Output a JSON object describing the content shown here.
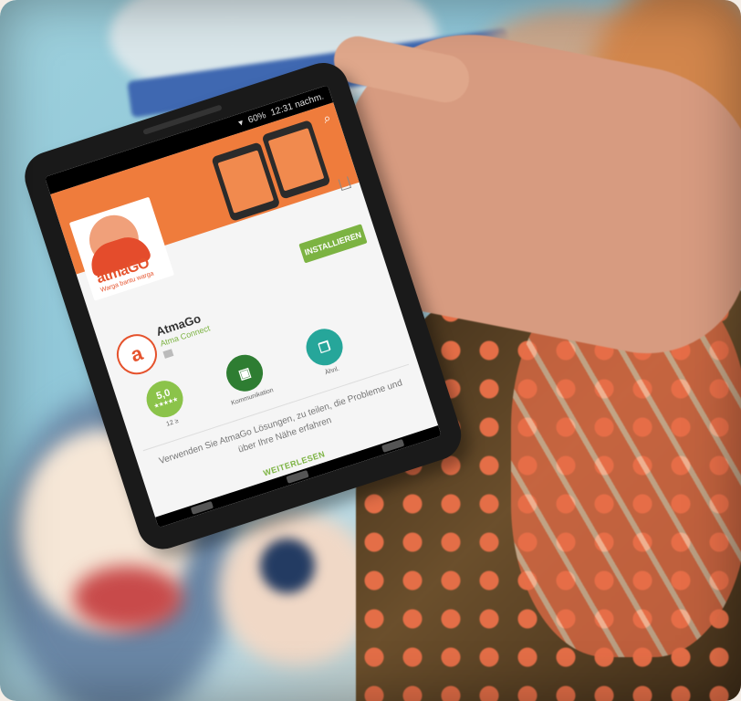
{
  "status_bar": {
    "signal": "▾",
    "battery": "60%",
    "time": "12:31 nachm."
  },
  "app_store_page": {
    "brand": "atmaGO",
    "tagline": "Warga bantu warga",
    "app_name": "AtmaGo",
    "developer": "Atma Connect",
    "install_label": "INSTALLIEREN",
    "badges": [
      {
        "value": "5,0",
        "sub": "★★★★★",
        "label": "12 ≥"
      },
      {
        "value": "▣",
        "label": "Kommunikation"
      },
      {
        "value": "❐",
        "label": "Ähnl."
      }
    ],
    "description": "Verwenden Sie AtmaGo Lösungen, zu teilen, die Probleme und über Ihre Nähe erfahren",
    "more_label": "WEITERLESEN"
  },
  "colors": {
    "accent": "#ef7c3c",
    "install": "#7cb342",
    "brand": "#e5522c"
  }
}
